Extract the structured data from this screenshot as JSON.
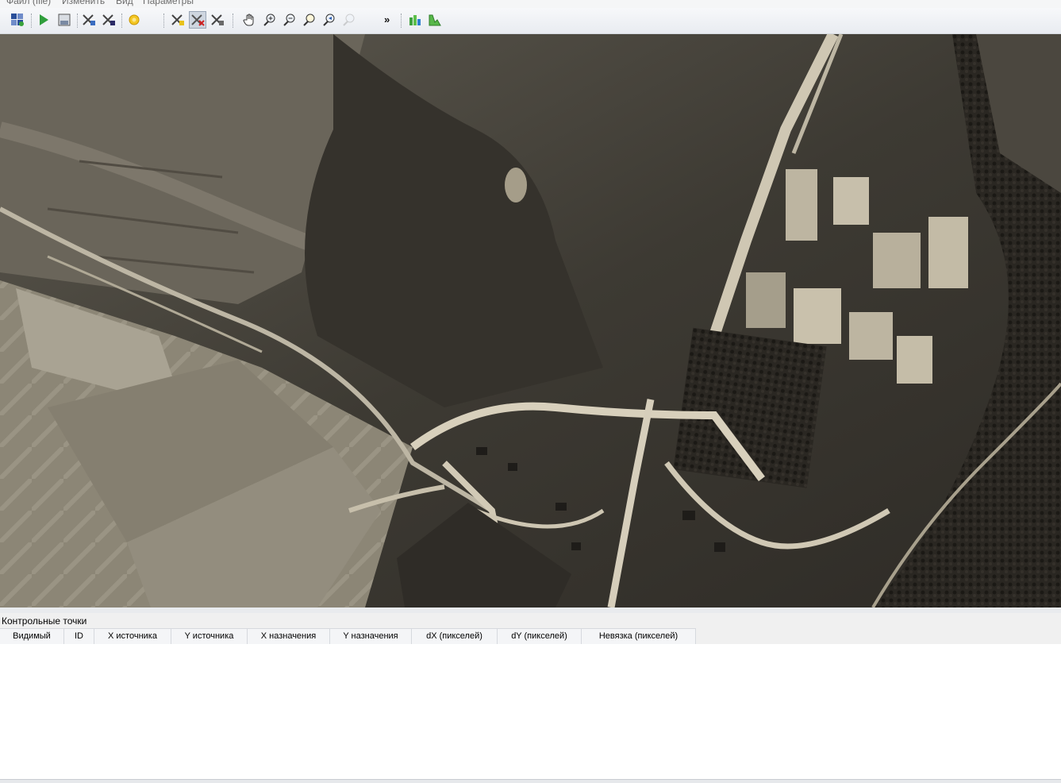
{
  "menubar": {
    "items": [
      "Файл (file)",
      "Изменить",
      "Вид",
      "Параметры"
    ]
  },
  "toolbar": {
    "buttons": [
      {
        "name": "open-raster-icon",
        "state": "normal"
      },
      {
        "name": "start-georeferencing-icon",
        "state": "normal"
      },
      {
        "name": "generate-gdal-script-icon",
        "state": "normal"
      },
      {
        "name": "load-gcp-points-icon",
        "state": "normal"
      },
      {
        "name": "save-gcp-points-icon",
        "state": "normal"
      },
      {
        "name": "transformation-settings-icon",
        "state": "normal"
      },
      {
        "name": "add-point-icon",
        "state": "normal"
      },
      {
        "name": "delete-point-icon",
        "state": "active"
      },
      {
        "name": "move-gcp-point-icon",
        "state": "normal"
      },
      {
        "name": "pan-icon",
        "state": "normal"
      },
      {
        "name": "zoom-in-icon",
        "state": "normal"
      },
      {
        "name": "zoom-out-icon",
        "state": "normal"
      },
      {
        "name": "zoom-to-layer-icon",
        "state": "normal"
      },
      {
        "name": "zoom-last-icon",
        "state": "normal"
      },
      {
        "name": "zoom-next-icon",
        "state": "disabled"
      },
      {
        "name": "link-georeferencer-to-qgis-icon",
        "state": "normal"
      },
      {
        "name": "full-histogram-stretch-icon",
        "state": "normal"
      }
    ],
    "more_label": "»"
  },
  "gcp_panel": {
    "title": "Контрольные точки",
    "columns": [
      "Видимый",
      "ID",
      "X источника",
      "Y источника",
      "X назначения",
      "Y назначения",
      "dX (пикселей)",
      "dY (пикселей)",
      "Невязка (пикселей)"
    ],
    "rows": []
  },
  "colors": {
    "photo_dark": "#2b2823",
    "photo_mid": "#5a554b",
    "photo_light": "#c9c2b0",
    "toolbar_active": "#cfd6e0"
  }
}
